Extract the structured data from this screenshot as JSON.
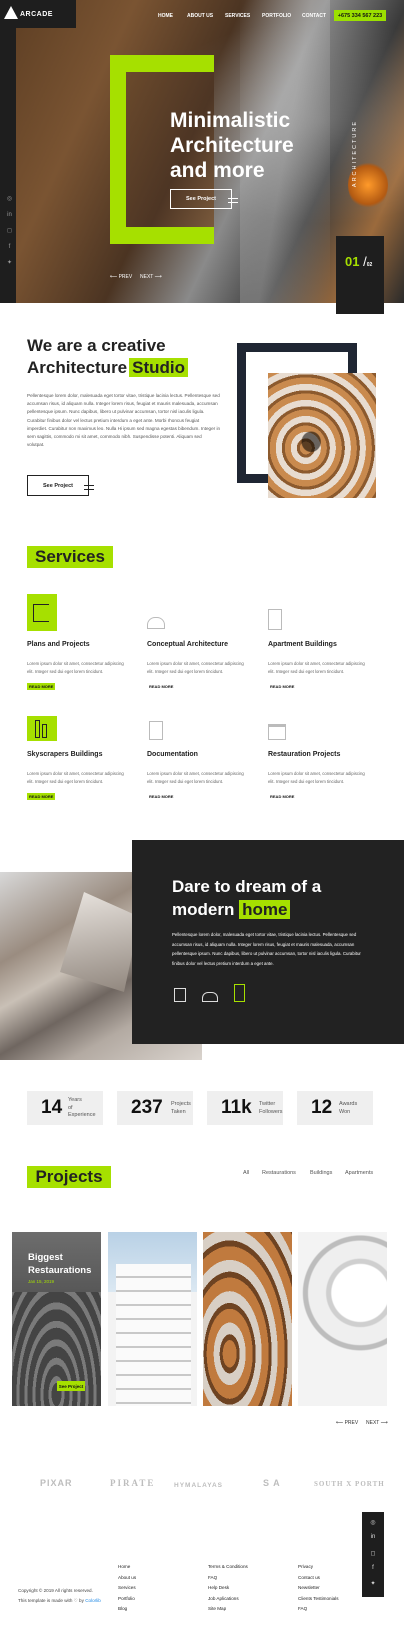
{
  "brand": {
    "name": "ARCADE"
  },
  "nav": {
    "items": [
      "HOME",
      "ABOUT US",
      "SERVICES",
      "PORTFOLIO",
      "CONTACT"
    ],
    "phone": "+675 334 567 223"
  },
  "hero": {
    "title_lines": [
      "Minimalistic",
      "Architecture",
      "and more"
    ],
    "button": "See Project",
    "prev": "PREV",
    "next": "NEXT",
    "slide_current": "01",
    "slide_sep": "/",
    "slide_total": "02",
    "vertical_text": "ARCHITECTURE",
    "social_icons": [
      "dribbble-icon",
      "linkedin-icon",
      "instagram-icon",
      "facebook-icon",
      "twitter-icon"
    ]
  },
  "about": {
    "title_line1": "We are a creative",
    "title_line2": "Architecture",
    "title_highlight": "Studio",
    "text_lines": [
      "Pellentesque lorem dolor, malesuada eget tortor vitae, tristique lacinia lectus. Pellentesque sed",
      "accumsan risus, id aliquam nulla. Integer lorem risus, feugiat et mauris malesuada, accumsan",
      "pellentesque ipsum. Nunc dapibus, libero ut pulvinar accumsan, tortor nisl iaculis ligula.",
      "Curabitur finibus dolor vel lectus pretium interdum a eget ante. Morbi rhoncus feugiat",
      "imperdiet. Curabitur non maximus leo. Nulla Hi ipsum sed magna egestas bibendum. Integer in",
      "sem sagittis, commodo mi sit amet, commodo nibh. Suspendisse potenti. Aliquam sed",
      "volutpat."
    ],
    "button": "See Project"
  },
  "services": {
    "title": "Services",
    "items": [
      {
        "title": "Plans and Projects",
        "text_lines": [
          "Lorem ipsum dolor sit amet, consectetur adipiscing",
          "elit. Integer sed dui eget lorem tincidunt."
        ],
        "more": "READ MORE",
        "icon": "blueprint-icon"
      },
      {
        "title": "Conceptual Architecture",
        "text_lines": [
          "Lorem ipsum dolor sit amet, consectetur adipiscing",
          "elit. Integer sed dui eget lorem tincidunt."
        ],
        "more": "READ MORE",
        "icon": "building-outline-icon"
      },
      {
        "title": "Apartment Buildings",
        "text_lines": [
          "Lorem ipsum dolor sit amet, consectetur adipiscing",
          "elit. Integer sed dui eget lorem tincidunt."
        ],
        "more": "READ MORE",
        "icon": "apartment-icon"
      },
      {
        "title": "Skyscrapers Buildings",
        "text_lines": [
          "Lorem ipsum dolor sit amet, consectetur adipiscing",
          "elit. Integer sed dui eget lorem tincidunt."
        ],
        "more": "READ MORE",
        "icon": "skyscraper-icon"
      },
      {
        "title": "Documentation",
        "text_lines": [
          "Lorem ipsum dolor sit amet, consectetur adipiscing",
          "elit. Integer sed dui eget lorem tincidunt."
        ],
        "more": "READ MORE",
        "icon": "document-icon"
      },
      {
        "title": "Restauration Projects",
        "text_lines": [
          "Lorem ipsum dolor sit amet, consectetur adipiscing",
          "elit. Integer sed dui eget lorem tincidunt."
        ],
        "more": "READ MORE",
        "icon": "temple-icon"
      }
    ]
  },
  "dream": {
    "title_line1": "Dare to dream of a",
    "title_line2": "modern",
    "title_highlight": "home",
    "text_lines": [
      "Pellentesque lorem dolor, malesuada eget tortor vitae, tristique lacinia lectus. Pellentesque sed",
      "accumsan risus, id aliquam nulla. Integer lorem risus, feugiat et mauris malesuada, accumsan",
      "pellentesque ipsum. Nunc dapibus, libero ut pulvinar accumsan, tortor nisl iaculis ligula. Curabitur",
      "finibus dolor vel lectus pretium interdum a eget ante."
    ]
  },
  "stats": [
    {
      "number": "14",
      "label_lines": [
        "Years",
        "of",
        "Experience"
      ]
    },
    {
      "number": "237",
      "label_lines": [
        "Projects",
        "Taken"
      ]
    },
    {
      "number": "11k",
      "label_lines": [
        "Twitter",
        "Followers"
      ]
    },
    {
      "number": "12",
      "label_lines": [
        "Awards",
        "Won"
      ]
    }
  ],
  "projects": {
    "title": "Projects",
    "filters": [
      "All",
      "Restaurations",
      "Buildings",
      "Apartments"
    ],
    "featured_title_lines": [
      "Biggest",
      "Restaurations"
    ],
    "featured_date": "Jan 15, 2019",
    "featured_button": "See Project",
    "prev": "PREV",
    "next": "NEXT"
  },
  "clients": [
    "PIXAR",
    "PIRATE",
    "HYMALAYAS",
    "S A",
    "SOUTH X PORTH"
  ],
  "footer": {
    "copyright_line1": "Copyright © 2019 All rights reserved.",
    "copyright_line2": "This template is made with ♡ by",
    "copyright_link": "Colorlib",
    "col1": [
      "Home",
      "About us",
      "Services",
      "Portfolio",
      "Blog"
    ],
    "col2": [
      "Terms & Conditions",
      "FAQ",
      "Help Desk",
      "Job Aplications",
      "Site Map"
    ],
    "col3": [
      "Privacy",
      "Contact us",
      "Newsletter",
      "Clients Testimonials",
      "FAQ"
    ]
  },
  "colors": {
    "accent": "#a6e000",
    "dark": "#1e1e1e"
  }
}
